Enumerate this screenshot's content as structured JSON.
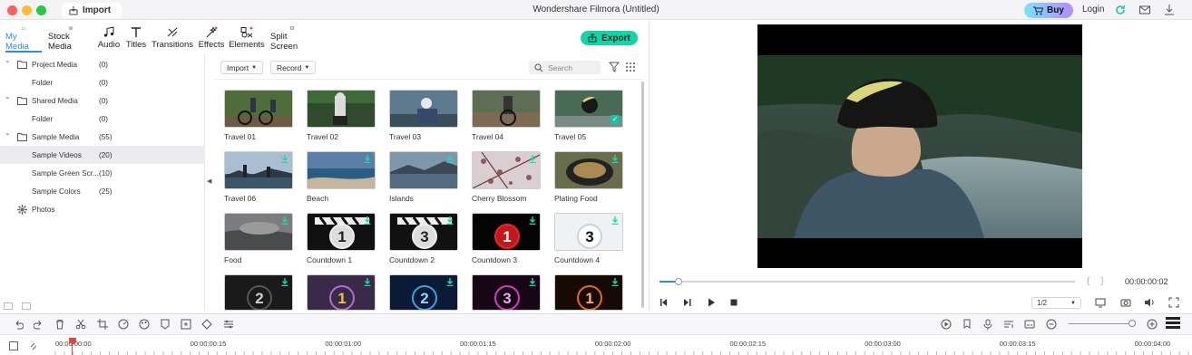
{
  "window": {
    "title": "Wondershare Filmora (Untitled)",
    "tab": "Import",
    "buy": "Buy",
    "login": "Login"
  },
  "nav": [
    {
      "label": "My Media",
      "icon": "folder-icon"
    },
    {
      "label": "Stock Media",
      "icon": "camera-icon"
    },
    {
      "label": "Audio",
      "icon": "music-note-icon"
    },
    {
      "label": "Titles",
      "icon": "text-icon"
    },
    {
      "label": "Transitions",
      "icon": "transition-icon"
    },
    {
      "label": "Effects",
      "icon": "effects-icon"
    },
    {
      "label": "Elements",
      "icon": "elements-icon"
    },
    {
      "label": "Split Screen",
      "icon": "split-screen-icon"
    }
  ],
  "export_label": "Export",
  "tree": [
    {
      "label": "Project Media",
      "count": "(0)"
    },
    {
      "label": "Folder",
      "count": "(0)"
    },
    {
      "label": "Shared Media",
      "count": "(0)"
    },
    {
      "label": "Folder",
      "count": "(0)"
    },
    {
      "label": "Sample Media",
      "count": "(55)"
    },
    {
      "label": "Sample Videos",
      "count": "(20)"
    },
    {
      "label": "Sample Green Scr...",
      "count": "(10)"
    },
    {
      "label": "Sample Colors",
      "count": "(25)"
    },
    {
      "label": "Photos",
      "count": ""
    }
  ],
  "media_toolbar": {
    "import": "Import",
    "record": "Record",
    "search_placeholder": "Search"
  },
  "media": [
    {
      "label": "Travel 01"
    },
    {
      "label": "Travel 02"
    },
    {
      "label": "Travel 03"
    },
    {
      "label": "Travel 04"
    },
    {
      "label": "Travel 05"
    },
    {
      "label": "Travel 06"
    },
    {
      "label": "Beach"
    },
    {
      "label": "Islands"
    },
    {
      "label": "Cherry Blossom"
    },
    {
      "label": "Plating Food"
    },
    {
      "label": "Food"
    },
    {
      "label": "Countdown 1"
    },
    {
      "label": "Countdown 2"
    },
    {
      "label": "Countdown 3"
    },
    {
      "label": "Countdown 4"
    },
    {
      "label": ""
    },
    {
      "label": ""
    },
    {
      "label": ""
    },
    {
      "label": ""
    },
    {
      "label": ""
    }
  ],
  "countdown_digits": [
    "1",
    "3",
    "1",
    "3",
    "2",
    "1",
    "2",
    "3",
    "1"
  ],
  "preview": {
    "timecode": "00:00:00:02",
    "ratio": "1/2",
    "progress_fraction": 0.045
  },
  "timeline": {
    "ticks": [
      "00:00:00:00",
      "00:00:00:15",
      "00:00:01:00",
      "00:00:01:15",
      "00:00:02:00",
      "00:00:02:15",
      "00:00:03:00",
      "00:00:03:15",
      "00:00:04:00"
    ]
  },
  "colors": {
    "accent": "#2b8eea",
    "export": "#16d2a7",
    "playhead": "#e8453c"
  }
}
